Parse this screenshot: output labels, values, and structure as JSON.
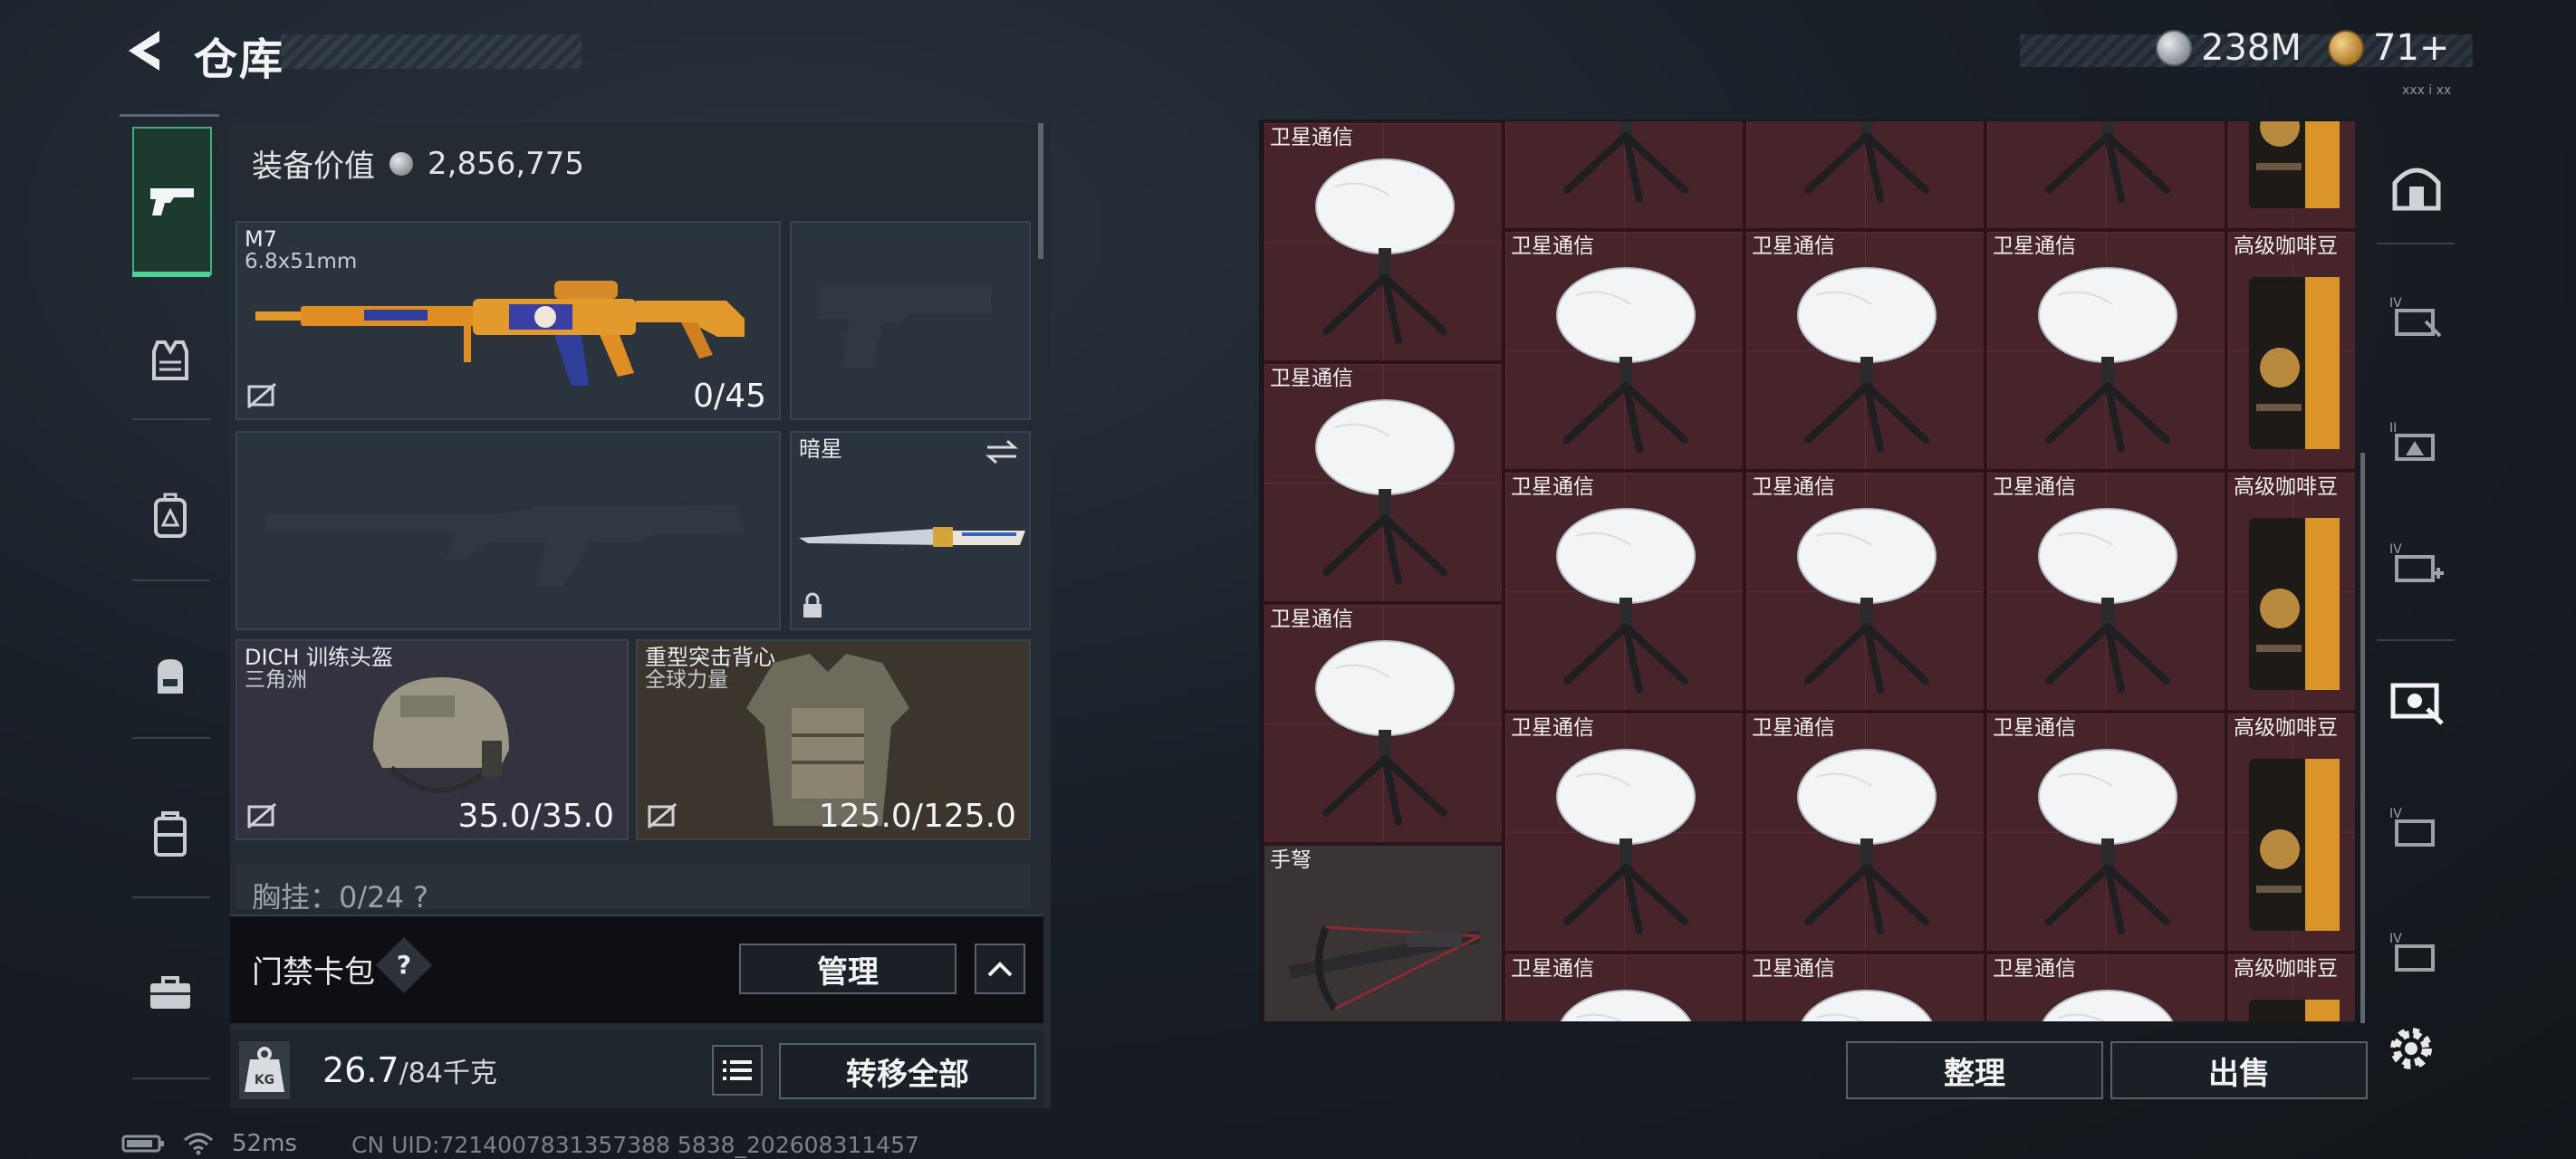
{
  "header": {
    "title": "仓库",
    "currency_silver": "238M",
    "currency_gold": "71+"
  },
  "version": "xxx i xx",
  "gear": {
    "equip_value_label": "装备价值",
    "equip_value": "2,856,775",
    "primary_weapon": {
      "name": "M7",
      "caliber": "6.8x51mm",
      "ammo": "0/45"
    },
    "melee": {
      "name": "暗星"
    },
    "helmet": {
      "name": "DICH 训练头盔",
      "faction": "三角洲",
      "durability": "35.0/35.0"
    },
    "vest": {
      "name": "重型突击背心",
      "faction": "全球力量",
      "durability": "125.0/125.0"
    },
    "chest_rig": "胸挂：0/24 ?"
  },
  "card_pack": {
    "label": "门禁卡包",
    "help": "?",
    "manage": "管理"
  },
  "weight": {
    "current": "26.7",
    "max_unit": "/84千克",
    "transfer_all": "转移全部"
  },
  "storage": {
    "items": {
      "sat": "卫星通信",
      "coffee": "高级咖啡豆",
      "crossbow": "手弩"
    },
    "sort": "整理",
    "sell": "出售"
  },
  "status": {
    "ping": "52ms",
    "uid": "CN UID:7214007831357388 5838_202608311457"
  },
  "colors": {
    "accent_green": "#49d29a",
    "storage_cell": "#47242a"
  }
}
